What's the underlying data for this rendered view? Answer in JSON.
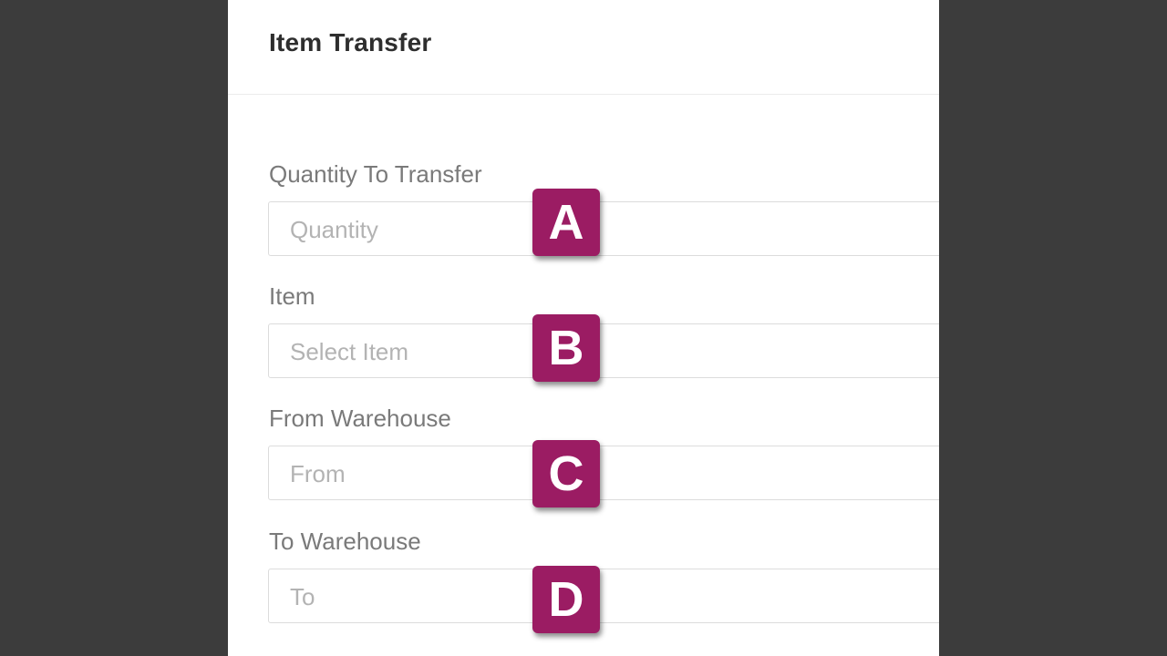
{
  "dialog": {
    "title": "Item Transfer"
  },
  "fields": [
    {
      "label": "Quantity To Transfer",
      "placeholder": "Quantity",
      "marker": "A"
    },
    {
      "label": "Item",
      "placeholder": "Select Item",
      "marker": "B"
    },
    {
      "label": "From Warehouse",
      "placeholder": "From",
      "marker": "C"
    },
    {
      "label": "To Warehouse",
      "placeholder": "To",
      "marker": "D"
    }
  ],
  "colors": {
    "backdrop": "#3c3c3c",
    "panel": "#ffffff",
    "marker": "#9b1c63"
  }
}
